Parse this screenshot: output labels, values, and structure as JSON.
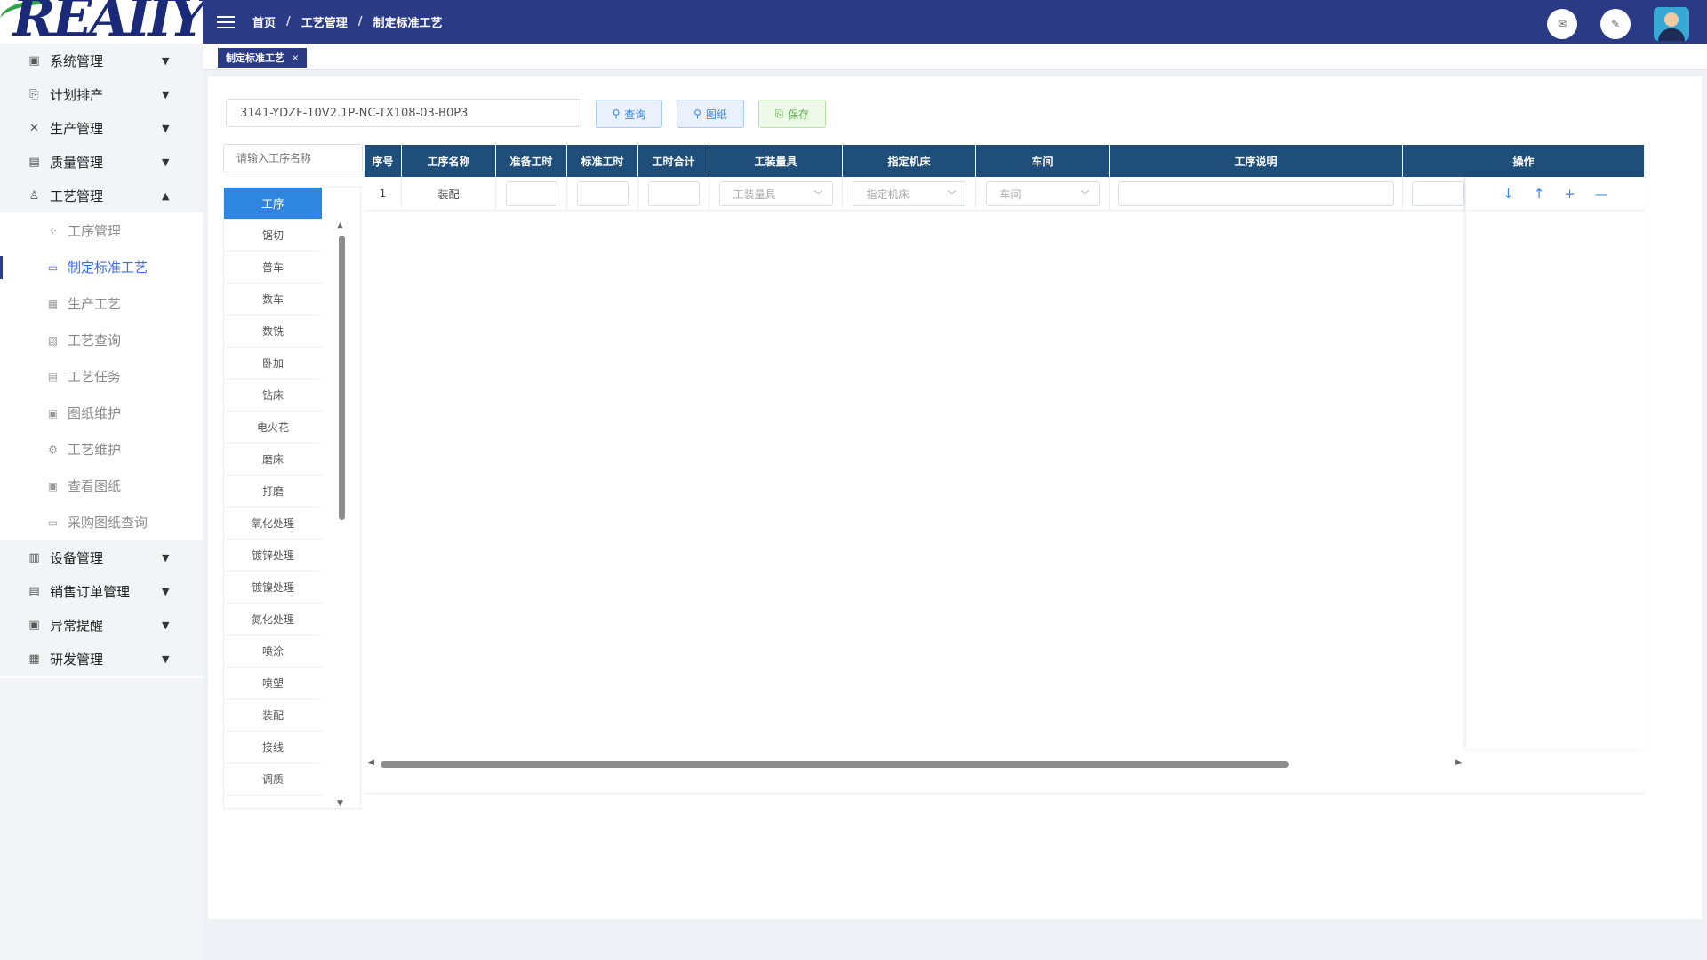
{
  "logo": {
    "text": "REAIIY"
  },
  "sidebar": {
    "groups_top": [
      {
        "label": "系统管理",
        "icon": "monitor-icon",
        "glyph": "▣"
      },
      {
        "label": "计划排产",
        "icon": "plan-icon",
        "glyph": "⎘"
      },
      {
        "label": "生产管理",
        "icon": "tools-icon",
        "glyph": "✕"
      },
      {
        "label": "质量管理",
        "icon": "document-icon",
        "glyph": "▤"
      },
      {
        "label": "工艺管理",
        "icon": "flask-icon",
        "glyph": "♙",
        "expanded": true
      }
    ],
    "sub_items": [
      {
        "label": "工序管理",
        "icon": "grid-icon",
        "glyph": "⁘"
      },
      {
        "label": "制定标准工艺",
        "icon": "edit-icon",
        "glyph": "▭",
        "active": true
      },
      {
        "label": "生产工艺",
        "icon": "chart-icon",
        "glyph": "▦"
      },
      {
        "label": "工艺查询",
        "icon": "search-doc-icon",
        "glyph": "▧"
      },
      {
        "label": "工艺任务",
        "icon": "list-icon",
        "glyph": "▤"
      },
      {
        "label": "图纸维护",
        "icon": "monitor-icon",
        "glyph": "▣"
      },
      {
        "label": "工艺维护",
        "icon": "wrench-icon",
        "glyph": "⚙"
      },
      {
        "label": "查看图纸",
        "icon": "monitor-icon",
        "glyph": "▣"
      },
      {
        "label": "采购图纸查询",
        "icon": "screen-icon",
        "glyph": "▭"
      }
    ],
    "groups_bottom": [
      {
        "label": "设备管理",
        "icon": "device-icon",
        "glyph": "▥"
      },
      {
        "label": "销售订单管理",
        "icon": "order-icon",
        "glyph": "▤"
      },
      {
        "label": "异常提醒",
        "icon": "alert-icon",
        "glyph": "▣"
      },
      {
        "label": "研发管理",
        "icon": "rd-icon",
        "glyph": "▦"
      }
    ]
  },
  "breadcrumb": {
    "home": "首页",
    "level1": "工艺管理",
    "level2": "制定标准工艺"
  },
  "tab": {
    "label": "制定标准工艺",
    "close": "×"
  },
  "toolbar": {
    "code_value": "3141-YDZF-10V2.1P-NC-TX108-03-B0P3",
    "query_label": "查询",
    "drawing_label": "图纸",
    "save_label": "保存"
  },
  "process_search": {
    "placeholder": "请输入工序名称"
  },
  "process_list": {
    "header": "工序",
    "items": [
      "锯切",
      "普车",
      "数车",
      "数铣",
      "卧加",
      "钻床",
      "电火花",
      "磨床",
      "打磨",
      "氧化处理",
      "镀锌处理",
      "镀镍处理",
      "氮化处理",
      "喷涂",
      "喷塑",
      "装配",
      "接线",
      "调质"
    ]
  },
  "table": {
    "columns": [
      "序号",
      "工序名称",
      "准备工时",
      "标准工时",
      "工时合计",
      "工装量具",
      "指定机床",
      "车间",
      "工序说明",
      "操作"
    ],
    "rows": [
      {
        "index": "1",
        "name": "装配",
        "fixture_placeholder": "工装量具",
        "machine_placeholder": "指定机床",
        "workshop_placeholder": "车间"
      }
    ],
    "ops": {
      "down": "↓",
      "up": "↑",
      "add": "+",
      "remove": "—"
    }
  },
  "colors": {
    "topbar": "#2b3a85",
    "table_header": "#1f4e7a",
    "accent_blue": "#2f86e0",
    "save_green": "#59b04a"
  }
}
